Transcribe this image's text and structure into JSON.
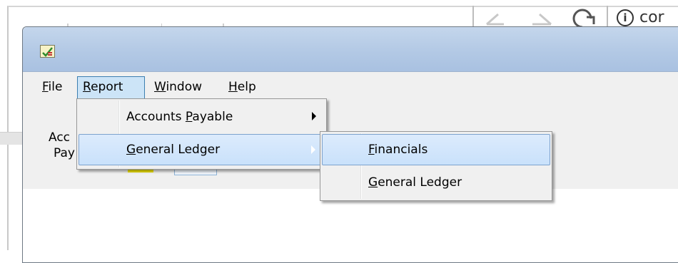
{
  "browser": {
    "url_fragment": "cor",
    "info_glyph": "i"
  },
  "app": {
    "icon": "app-checkmark-icon"
  },
  "menubar": {
    "items": [
      "File",
      "Report",
      "Window",
      "Help"
    ],
    "mnemonics": [
      "F",
      "R",
      "W",
      "H"
    ],
    "active": "Report"
  },
  "content": {
    "label_line1": "Acc",
    "label_line2": "Pay"
  },
  "report_menu": {
    "items": [
      {
        "pre": "Accounts ",
        "key": "P",
        "post": "ayable",
        "has_submenu": true
      },
      {
        "pre": "",
        "key": "G",
        "post": "eneral Ledger",
        "has_submenu": true,
        "highlighted": true
      }
    ]
  },
  "gl_submenu": {
    "items": [
      {
        "pre": "",
        "key": "F",
        "post": "inancials",
        "highlighted": true
      },
      {
        "pre": "",
        "key": "G",
        "post": "eneral Ledger"
      }
    ]
  },
  "colors": {
    "highlight": "#cce4f7",
    "titlebar": "#b3c9e5",
    "menu_bg": "#f0f0f0"
  }
}
